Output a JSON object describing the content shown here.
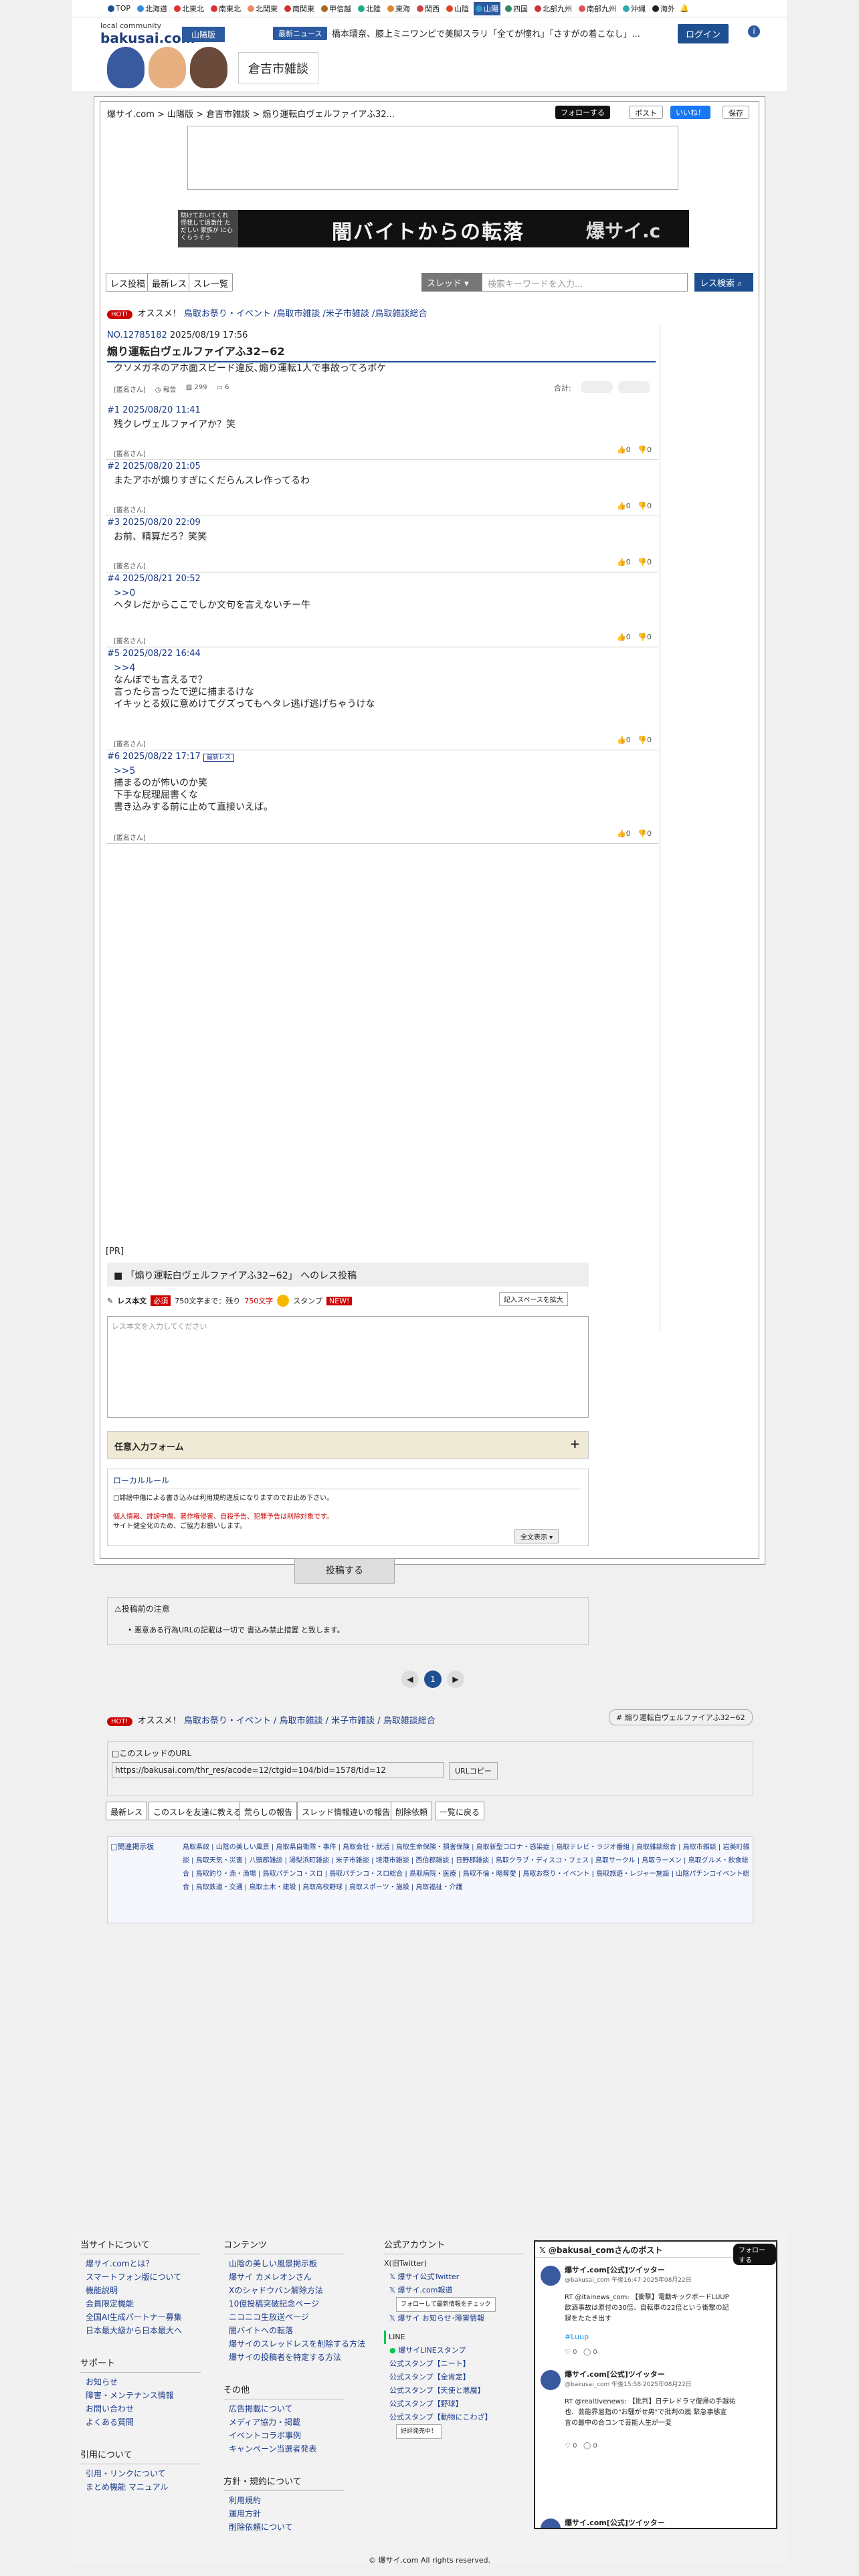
{
  "topnav": [
    "TOP",
    "北海道",
    "北東北",
    "南東北",
    "北関東",
    "南関東",
    "甲信越",
    "北陸",
    "東海",
    "関西",
    "山陰",
    "山陽",
    "四国",
    "北部九州",
    "南部九州",
    "沖縄",
    "海外"
  ],
  "topnav_active": "山陽",
  "header": {
    "logo_small": "local community",
    "logo_big": "bakusai.com",
    "region": "山陽版",
    "news_badge": "最新ニュース",
    "news": "橋本環奈、膝上ミニワンピで美脚スラリ「全てが憧れ」「さすがの着こなし」...",
    "login": "ログイン",
    "board": "倉吉市雑談"
  },
  "breadcrumb": "爆サイ.com > 山陽版 > 倉吉市雑談 > 煽り運転白ヴェルファイアふ32...",
  "share": {
    "follow": "フォローする",
    "post": "ポスト",
    "like": "いいね！",
    "save": "保存"
  },
  "banner": {
    "small": "助けておいてくれ\n怪我して過激仕\nただしい 家族が\nに心くらうそう",
    "main": "闇バイトからの転落",
    "brand": "爆サイ.c"
  },
  "tools": {
    "res_post": "レス投稿",
    "new_res": "最新レス",
    "res_list": "スレ一覧",
    "select": "スレッド",
    "search_placeholder": "検索キーワードを入力...",
    "search_btn": "レス検索"
  },
  "osusume": {
    "hot": "HOT!",
    "label": "オススメ！",
    "links": "鳥取お祭り・イベント /鳥取市雑談 /米子市雑談 /鳥取雑談総合"
  },
  "thread": {
    "no": "NO.12785182",
    "date": "2025/08/19 17:56",
    "title": "煽り運転白ヴェルファイアふ32−62",
    "body": "クソメガネのアホ面スピード違反､煽り運転1人で事故ってろボケ",
    "name": "[匿名さん]",
    "report": "報告",
    "views": "299",
    "res": "6",
    "total": "合計:"
  },
  "posts": [
    {
      "hd": "#1 2025/08/20 11:41",
      "tx": "残クレヴェルファイアか？笑",
      "name": "[匿名さん]",
      "up": "0",
      "down": "0"
    },
    {
      "hd": "#2 2025/08/20 21:05",
      "tx": "またアホが煽りすぎにくだらんスレ作ってるわ",
      "name": "[匿名さん]",
      "up": "0",
      "down": "0"
    },
    {
      "hd": "#3 2025/08/20 22:09",
      "tx": "お前、精算だろ？笑笑",
      "name": "[匿名さん]",
      "up": "0",
      "down": "0"
    },
    {
      "hd": "#4 2025/08/21 20:52",
      "quote": ">>0",
      "tx": "ヘタレだからここでしか文句を言えないチー牛",
      "name": "[匿名さん]",
      "up": "0",
      "down": "0"
    },
    {
      "hd": "#5 2025/08/22 16:44",
      "quote": ">>4",
      "tx": "なんぼでも言えるで？\n言ったら言ったで逆に捕まるけな\nイキッとる奴に意めけてグズってもヘタレ逃げ逃げちゃうけな",
      "name": "[匿名さん]",
      "up": "0",
      "down": "0"
    },
    {
      "hd": "#6 2025/08/22 17:17",
      "badge": "最新レス",
      "quote": ">>5",
      "tx": "捕まるのが怖いのか笑\n下手な屁理屈書くな\n書き込みする前に止めて直接いえば。",
      "name": "[匿名さん]",
      "up": "0",
      "down": "0"
    }
  ],
  "pr": "[PR]",
  "form": {
    "title": "「煽り運転白ヴェルファイアふ32−62」 へのレス投稿",
    "res_label": "レス本文",
    "required": "必須",
    "limit": "750文字まで：残り",
    "remain": "750文字",
    "stamp": "スタンプ",
    "new": "NEW!",
    "expand": "記入スペースを拡大",
    "placeholder": "レス本文を入力してください",
    "optional": "任意入力フォーム",
    "local_rule": "ローカルルール",
    "rule1": "□誹謗中傷による書き込みは利用規約違反になりますのでお止め下さい。",
    "rule2": "個人情報、誹謗中傷、著作権侵害、自殺予告、犯罪予告は削除対象です。",
    "rule3": "サイト健全化のため、ご協力お願いします。",
    "show_all": "全文表示",
    "submit": "投稿する",
    "notice_title": "投稿前の注意",
    "notice": "悪意ある行為URLの記載は一切で 書込み禁止措置 と致します。"
  },
  "pager": {
    "cur": "1"
  },
  "osusume2": {
    "links": "鳥取お祭り・イベント / 鳥取市雑談 / 米子市雑談 / 鳥取雑談総合",
    "tag": "煽り運転白ヴェルファイアふ32−62"
  },
  "url": {
    "label": "□このスレッドのURL",
    "value": "https://bakusai.com/thr_res/acode=12/ctgid=104/bid=1578/tid=12",
    "copy": "URLコピー"
  },
  "bottom_btns": [
    "最新レス",
    "このスレを友達に教える",
    "荒らしの報告",
    "スレッド情報違いの報告",
    "削除依頼",
    "一覧に戻る"
  ],
  "related": {
    "label": "関連掲示板",
    "tags": "鳥取県政 | 山陰の美しい風景 | 鳥取県自衛隊・事件 | 鳥取会社・就活 | 鳥取生命保険・損害保険 | 鳥取新型コロナ・感染症 | 鳥取テレビ・ラジオ番組 | 鳥取雑談総合 | 鳥取市雑談 | 岩美町雑談 | 鳥取天気・災害 | 八頭郡雑談 | 湯梨浜町雑談 | 米子市雑談 | 境港市雑談 | 西伯郡雑談 | 日野郡雑談 | 鳥取クラブ・ディスコ・フェス | 鳥取サークル | 鳥取ラーメン | 鳥取グルメ・飲食総合 | 鳥取釣り・漁・漁場 | 鳥取パチンコ・スロ | 鳥取パチンコ・スロ総合 | 鳥取病院・医療 | 鳥取不倫・略奪愛 | 鳥取お祭り・イベント | 鳥取旅遊・レジャー施設 | 山陰パチンコイベント総合 | 鳥取鉄道・交通 | 鳥取土木・建設 | 鳥取高校野球 | 鳥取スポーツ・施設 | 鳥取福祉・介護"
  },
  "footer": {
    "about": {
      "h": "当サイトについて",
      "items": [
        "爆サイ.comとは？",
        "スマートフォン版について",
        "機能説明",
        "会員限定機能",
        "全国AI生成パートナー募集",
        "日本最大級から日本最大へ"
      ]
    },
    "support": {
      "h": "サポート",
      "items": [
        "お知らせ",
        "障害・メンテナンス情報",
        "お問い合わせ",
        "よくある質問"
      ]
    },
    "link": {
      "h": "引用について",
      "items": [
        "引用・リンクについて",
        "まとめ機能 マニュアル"
      ]
    },
    "contents": {
      "h": "コンテンツ",
      "items": [
        "山陰の美しい風景掲示板",
        "爆サイ カメレオンさん",
        "Xのシャドウバン解除方法",
        "10億投稿突破記念ページ",
        "ニコニコ生放送ページ",
        "闇バイトへの転落",
        "爆サイのスレッドレスを削除する方法",
        "爆サイの投稿者を特定する方法"
      ]
    },
    "other": {
      "h": "その他",
      "items": [
        "広告掲載について",
        "メディア協力・掲載",
        "イベントコラボ事例",
        "キャンペーン当選者発表"
      ]
    },
    "policy": {
      "h": "方針・規約について",
      "items": [
        "利用規約",
        "運用方針",
        "削除依頼について"
      ]
    },
    "official": {
      "h": "公式アカウント",
      "x": "X(旧Twitter)",
      "x1": "爆サイ公式Twitter",
      "x2": "爆サイ.com報道",
      "follow_check": "フォローして最新情報をチェック",
      "x3": "爆サイ お知らせ･障害情報",
      "line": "LINE",
      "line1": "爆サイLINEスタンプ",
      "st1": "公式スタンプ【ニート】",
      "st2": "公式スタンプ【全肯定】",
      "st3": "公式スタンプ【天使と悪魔】",
      "st4": "公式スタンプ【野球】",
      "st5": "公式スタンプ【動物にこわざ】",
      "st_btn": "好評発売中！"
    },
    "tw": {
      "head": "@bakusai_comさんのポスト",
      "follow": "フォローする",
      "t1name": "爆サイ.com[公式]ツイッター",
      "t1meta": "@bakusai_com 午後16:47·2025年08月22日",
      "t1body": "RT @itainews_com: 【衝撃】電動キックボードLUUP\n飲酒事故は原付の30倍、自転車の22倍という衝撃の記\n録をたたき出す",
      "t1tag": "#Luup",
      "t2name": "爆サイ.com[公式]ツイッター",
      "t2meta": "@bakusai_com 午後15:58·2025年08月22日",
      "t2body": "RT @realtivenews: 【批判】日テレドラマ復帰の手越祐\n也、芸能界屈指の\"お騒がせ男\"で批判の嵐 緊急事態宣\n言の最中の合コンで芸能人生が一変",
      "t3name": "爆サイ.com[公式]ツイッター"
    }
  },
  "copyright": "© 爆サイ.com All rights reserved."
}
